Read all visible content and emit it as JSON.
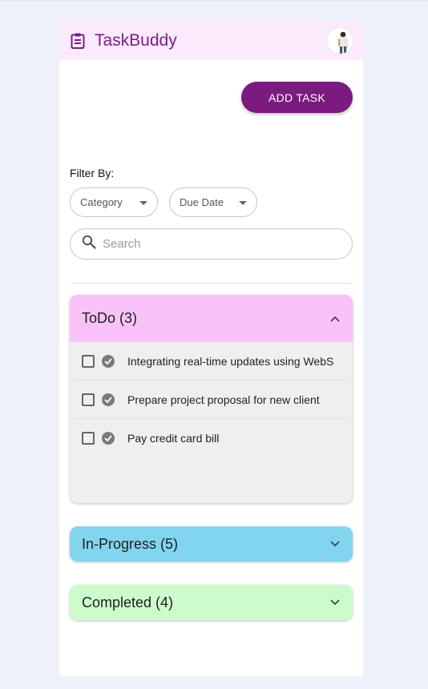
{
  "app": {
    "title": "TaskBuddy",
    "logo_icon": "clipboard-icon",
    "avatar": "user-avatar"
  },
  "actions": {
    "add_task": "ADD TASK"
  },
  "filters": {
    "label": "Filter By:",
    "category": {
      "selected": "Category"
    },
    "due_date": {
      "selected": "Due Date"
    }
  },
  "search": {
    "placeholder": "Search",
    "value": ""
  },
  "sections": [
    {
      "title": "ToDo (3)",
      "expanded": true,
      "color": "#f8c2f8",
      "tasks": [
        {
          "text": "Integrating real-time updates using WebS"
        },
        {
          "text": "Prepare project proposal for new client"
        },
        {
          "text": "Pay credit card bill"
        }
      ]
    },
    {
      "title": "In-Progress (5)",
      "expanded": false,
      "color": "#82d5ef"
    },
    {
      "title": "Completed (4)",
      "expanded": false,
      "color": "#ccfccc"
    }
  ],
  "colors": {
    "brand": "#7b1e86",
    "button": "#7b1a7f",
    "header_bg": "#fbeafb"
  }
}
